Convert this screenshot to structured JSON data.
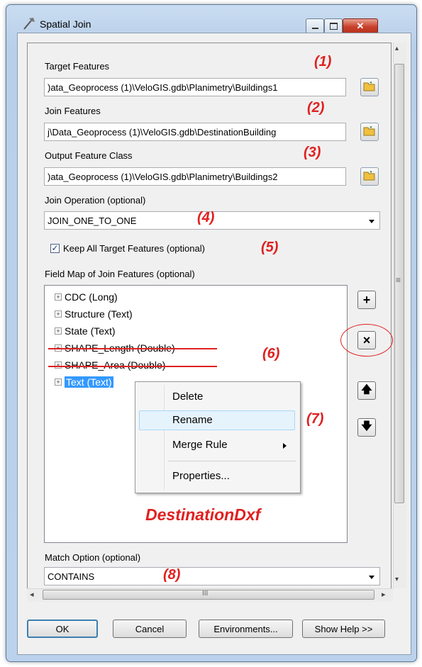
{
  "window": {
    "title": "Spatial Join",
    "minimize_icon": "minimize-icon",
    "maximize_icon": "maximize-icon",
    "close_icon": "close-icon",
    "accent": "#c7402a"
  },
  "target_features": {
    "label": "Target Features",
    "value": ")ata_Geoprocess (1)\\VeloGIS.gdb\\Planimetry\\Buildings1",
    "annotation": "(1)"
  },
  "join_features": {
    "label": "Join Features",
    "value": "j\\Data_Geoprocess (1)\\VeloGIS.gdb\\DestinationBuilding",
    "annotation": "(2)"
  },
  "output_feature_class": {
    "label": "Output Feature Class",
    "value": ")ata_Geoprocess (1)\\VeloGIS.gdb\\Planimetry\\Buildings2",
    "annotation": "(3)"
  },
  "join_operation": {
    "label": "Join Operation (optional)",
    "value": "JOIN_ONE_TO_ONE",
    "annotation": "(4)"
  },
  "keep_all": {
    "label": "Keep All Target Features (optional)",
    "checked": true,
    "annotation": "(5)"
  },
  "field_map": {
    "label": "Field Map of Join Features (optional)",
    "fields": [
      {
        "label": "CDC (Long)"
      },
      {
        "label": "Structure (Text)"
      },
      {
        "label": "State (Text)"
      },
      {
        "label": "SHAPE_Length (Double)"
      },
      {
        "label": "SHAPE_Area (Double)"
      },
      {
        "label": "Text (Text)"
      }
    ],
    "annotation_6": "(6)",
    "annotation_7": "(7)",
    "watermark": "DestinationDxf"
  },
  "context_menu": {
    "items": [
      "Delete",
      "Rename",
      "Merge Rule",
      "Properties..."
    ]
  },
  "side_buttons": {
    "add": "+",
    "remove": "×",
    "up": "🡅",
    "down": "🡇"
  },
  "match_option": {
    "label": "Match Option (optional)",
    "value": "CONTAINS",
    "annotation": "(8)"
  },
  "scroll": {
    "h_grip": "III",
    "left_arrow": "◂",
    "right_arrow": "▸",
    "v_grip": "≡",
    "up_arrow": "▴",
    "down_arrow": "▾"
  },
  "buttons": {
    "ok": "OK",
    "cancel": "Cancel",
    "environments": "Environments...",
    "help": "Show Help >>"
  }
}
